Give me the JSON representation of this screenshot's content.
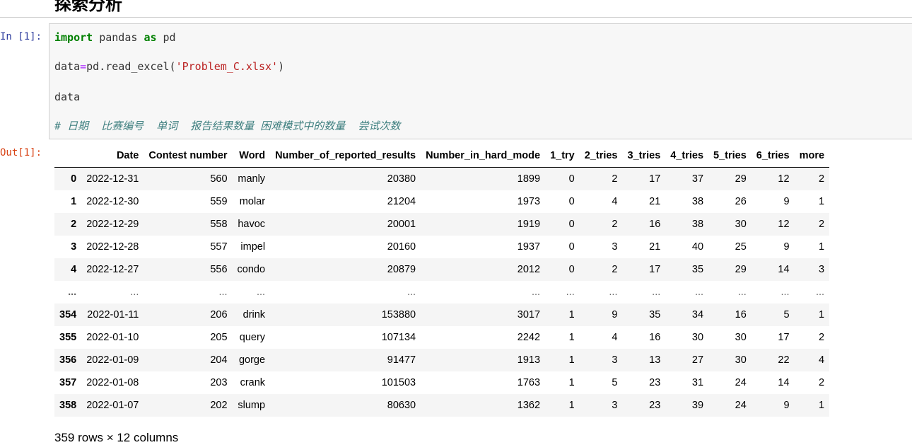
{
  "notebook": {
    "heading": "探索分析",
    "in_prompt": "In [1]:",
    "out_prompt": "Out[1]:"
  },
  "code": {
    "line1": {
      "kw1": "import",
      "mid": " pandas ",
      "kw2": "as",
      "end": " pd"
    },
    "line2": {
      "pre": "data",
      "eq": "=",
      "call": "pd.read_excel(",
      "str": "'Problem_C.xlsx'",
      "close": ")"
    },
    "line3": "data",
    "line4": "# 日期  比赛编号  单词  报告结果数量 困难模式中的数量  尝试次数"
  },
  "table": {
    "columns": [
      "",
      "Date",
      "Contest number",
      "Word",
      "Number_of_reported_results",
      "Number_in_hard_mode",
      "1_try",
      "2_tries",
      "3_tries",
      "4_tries",
      "5_tries",
      "6_tries",
      "more"
    ],
    "rows": [
      [
        "0",
        "2022-12-31",
        "560",
        "manly",
        "20380",
        "1899",
        "0",
        "2",
        "17",
        "37",
        "29",
        "12",
        "2"
      ],
      [
        "1",
        "2022-12-30",
        "559",
        "molar",
        "21204",
        "1973",
        "0",
        "4",
        "21",
        "38",
        "26",
        "9",
        "1"
      ],
      [
        "2",
        "2022-12-29",
        "558",
        "havoc",
        "20001",
        "1919",
        "0",
        "2",
        "16",
        "38",
        "30",
        "12",
        "2"
      ],
      [
        "3",
        "2022-12-28",
        "557",
        "impel",
        "20160",
        "1937",
        "0",
        "3",
        "21",
        "40",
        "25",
        "9",
        "1"
      ],
      [
        "4",
        "2022-12-27",
        "556",
        "condo",
        "20879",
        "2012",
        "0",
        "2",
        "17",
        "35",
        "29",
        "14",
        "3"
      ],
      [
        "...",
        "...",
        "...",
        "...",
        "...",
        "...",
        "...",
        "...",
        "...",
        "...",
        "...",
        "...",
        "..."
      ],
      [
        "354",
        "2022-01-11",
        "206",
        "drink",
        "153880",
        "3017",
        "1",
        "9",
        "35",
        "34",
        "16",
        "5",
        "1"
      ],
      [
        "355",
        "2022-01-10",
        "205",
        "query",
        "107134",
        "2242",
        "1",
        "4",
        "16",
        "30",
        "30",
        "17",
        "2"
      ],
      [
        "356",
        "2022-01-09",
        "204",
        "gorge",
        "91477",
        "1913",
        "1",
        "3",
        "13",
        "27",
        "30",
        "22",
        "4"
      ],
      [
        "357",
        "2022-01-08",
        "203",
        "crank",
        "101503",
        "1763",
        "1",
        "5",
        "23",
        "31",
        "24",
        "14",
        "2"
      ],
      [
        "358",
        "2022-01-07",
        "202",
        "slump",
        "80630",
        "1362",
        "1",
        "3",
        "23",
        "39",
        "24",
        "9",
        "1"
      ]
    ],
    "footer": "359 rows × 12 columns"
  }
}
